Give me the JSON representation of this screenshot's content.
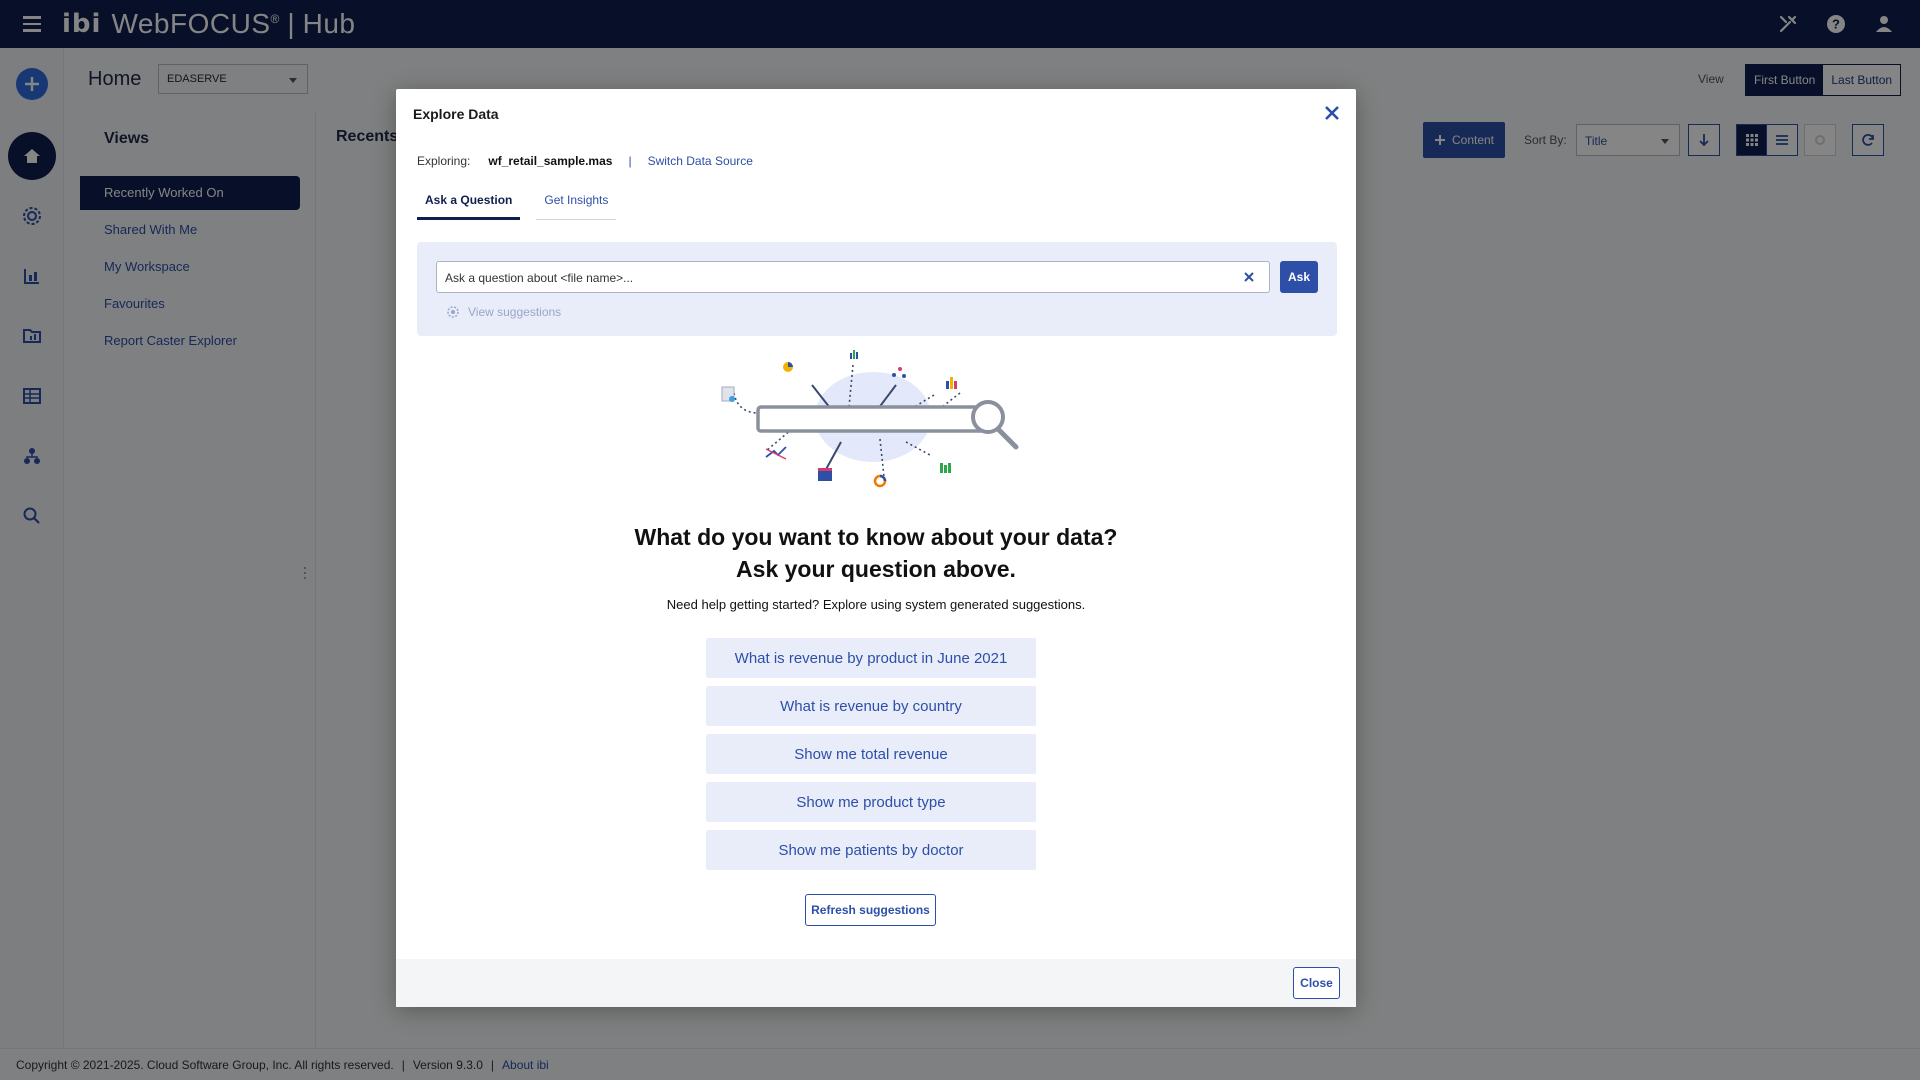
{
  "topbar": {
    "logo": "ibi",
    "app_name": "WebFOCUS",
    "reg_mark": "®",
    "separator": "|",
    "product": "Hub"
  },
  "home": {
    "title": "Home",
    "server": "EDASERVE",
    "view_label": "View",
    "view_buttons": [
      "First Button",
      "Last Button"
    ]
  },
  "views": {
    "title": "Views",
    "items": [
      {
        "label": "Recently Worked On"
      },
      {
        "label": "Shared With Me"
      },
      {
        "label": "My Workspace"
      },
      {
        "label": "Favourites"
      },
      {
        "label": "Report Caster Explorer"
      }
    ]
  },
  "recents": {
    "title": "Recents",
    "content_button": "Content",
    "sort_label": "Sort By:",
    "sort_value": "Title"
  },
  "footer": {
    "copyright": "Copyright © 2021-2025. Cloud Software Group, Inc. All rights reserved.",
    "sep1": "|",
    "version": "Version 9.3.0",
    "sep2": "|",
    "about": "About ibi"
  },
  "modal": {
    "title": "Explore Data",
    "exploring_label": "Exploring:",
    "file": "wf_retail_sample.mas",
    "pipe": "|",
    "switch_link": "Switch Data Source",
    "tabs": [
      "Ask a Question",
      "Get Insights"
    ],
    "ask_placeholder": "Ask a question about <file name>...",
    "ask_button": "Ask",
    "view_suggestions": "View suggestions",
    "headline_line1": "What do you want to know about your data?",
    "headline_line2": "Ask your question above.",
    "subline": "Need help getting started? Explore using system generated suggestions.",
    "suggestions": [
      "What is revenue by product in June 2021",
      "What is revenue by country",
      "Show me total revenue",
      "Show me product type",
      "Show me patients by doctor"
    ],
    "refresh_button": "Refresh suggestions",
    "close_button": "Close"
  },
  "colors": {
    "navy": "#0f1f4d",
    "accent": "#2d4fa8",
    "panel_bg": "#e9edfa"
  },
  "icons": [
    "menu-icon",
    "tools-icon",
    "help-icon",
    "user-icon",
    "add-icon",
    "home-icon",
    "settings-icon",
    "reports-icon",
    "folder-chart-icon",
    "table-icon",
    "tree-icon",
    "search-icon",
    "close-icon",
    "sparkle-icon",
    "sort-down-icon",
    "grid-view-icon",
    "list-view-icon",
    "refresh-icon"
  ]
}
